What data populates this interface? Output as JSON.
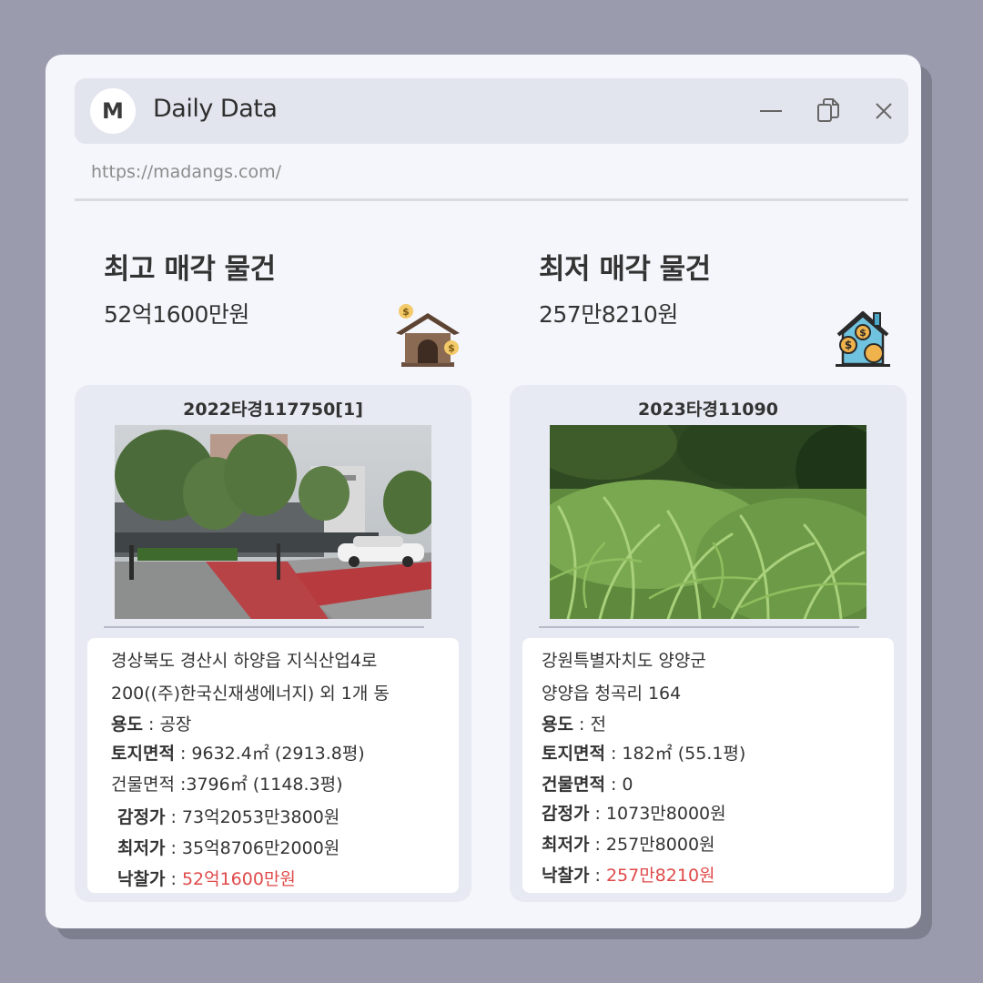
{
  "app": {
    "logo_letter": "M",
    "title": "Daily Data",
    "url": "https://madangs.com/"
  },
  "highest": {
    "section_title": "최고 매각 물건",
    "price": "52억1600만원",
    "case_no": "2022타경117750[1]",
    "address_line1": "경상북도 경산시 하양읍 지식산업4로",
    "address_line2": "200((주)한국신재생에너지) 외 1개 동",
    "usage_label": "용도",
    "usage_value": " : 공장",
    "land_label": "토지면적",
    "land_value": " : 9632.4㎡ (2913.8평)",
    "building_label": "건물면적",
    "building_value": " :3796㎡ (1148.3평)",
    "appraisal_label": "감정가",
    "appraisal_value": " : 73억2053만3800원",
    "minimum_label": "최저가",
    "minimum_value": " : 35억8706만2000원",
    "winning_label": "낙찰가",
    "winning_sep": " : ",
    "winning_value": "52억1600만원"
  },
  "lowest": {
    "section_title": "최저 매각 물건",
    "price": "257만8210원",
    "case_no": "2023타경11090",
    "address_line1": "강원특별자치도 양양군",
    "address_line2": "양양읍 청곡리 164",
    "usage_label": "용도",
    "usage_value": " : 전",
    "land_label": "토지면적",
    "land_value": " : 182㎡ (55.1평)",
    "building_label": "건물면적",
    "building_value": " : 0",
    "appraisal_label": "감정가",
    "appraisal_value": " : 1073만8000원",
    "minimum_label": "최저가",
    "minimum_value": " : 257만8000원",
    "winning_label": "낙찰가",
    "winning_sep": " : ",
    "winning_value": "257만8210원"
  },
  "icons": {
    "highest_icon": "house-with-coins-icon",
    "lowest_icon": "house-with-dollar-coins-icon",
    "minimize": "minimize-icon",
    "restore": "restore-icon",
    "close": "close-icon"
  },
  "colors": {
    "accent_red": "#e04a4a",
    "window_bg": "#f5f6fb",
    "card_bg": "#e8eaf3",
    "titlebar_bg": "#e3e5ee"
  },
  "__symbol_glyphs": "$$$$"
}
